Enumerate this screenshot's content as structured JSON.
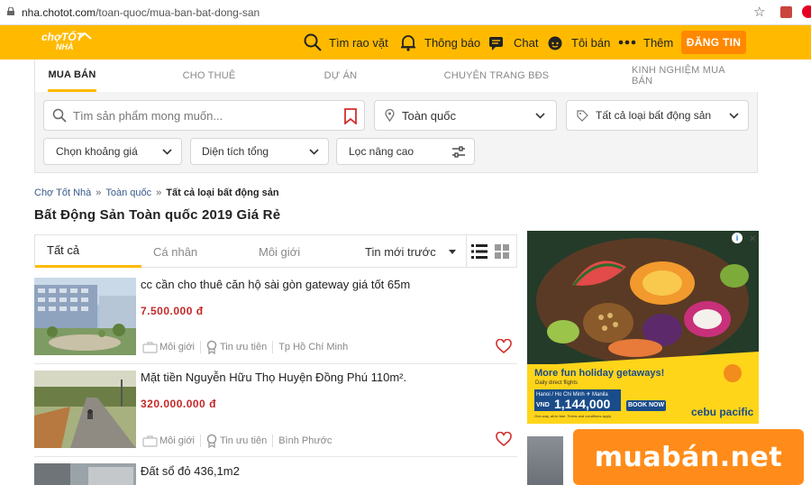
{
  "browser": {
    "url_host": "nha.chotot.com",
    "url_path": "/toan-quoc/mua-ban-bat-dong-san"
  },
  "header": {
    "logo_top": "chợTỐT",
    "logo_bottom": "NHÀ",
    "nav": [
      {
        "label": "Tìm rao vặt",
        "icon": "search-icon"
      },
      {
        "label": "Thông báo",
        "icon": "bell-icon"
      },
      {
        "label": "Chat",
        "icon": "chat-icon"
      },
      {
        "label": "Tôi bán",
        "icon": "user-face-icon"
      },
      {
        "label": "Thêm",
        "icon": "more-dots-icon"
      }
    ],
    "post_button": "ĐĂNG TIN",
    "brand_color": "#ffba00"
  },
  "search": {
    "tabs": [
      {
        "label": "MUA BÁN",
        "active": true
      },
      {
        "label": "CHO THUÊ",
        "active": false
      },
      {
        "label": "DỰ ÁN",
        "active": false
      },
      {
        "label": "CHUYÊN TRANG BĐS",
        "active": false
      },
      {
        "label": "KINH NGHIỆM MUA BÁN",
        "active": false
      }
    ],
    "keyword_placeholder": "Tìm sản phẩm mong muốn...",
    "location": "Toàn quốc",
    "category": "Tất cả loại bất động sản",
    "price_range": "Chọn khoảng giá",
    "area": "Diện tích tổng",
    "advanced_filter": "Lọc nâng cao"
  },
  "breadcrumb": {
    "items": [
      "Chợ Tốt Nhà",
      "Toàn quốc"
    ],
    "current": "Tất cả loại bất động sản",
    "separator": "»"
  },
  "page_title": "Bất Động Sản Toàn quốc 2019 Giá Rẻ",
  "list_filter": {
    "tabs": [
      "Tất cả",
      "Cá nhân",
      "Môi giới"
    ],
    "sort": "Tin mới trước"
  },
  "listings": [
    {
      "title": "cc cần cho thuê căn hộ sài gòn gateway giá tốt 65m",
      "price": "7.500.000 đ",
      "seller_type": "Môi giới",
      "badge": "Tin ưu tiên",
      "location": "Tp Hồ Chí Minh"
    },
    {
      "title": "Mặt tiền Nguyễn Hữu Thọ Huyện Đồng Phú 110m².",
      "price": "320.000.000 đ",
      "seller_type": "Môi giới",
      "badge": "Tin ưu tiên",
      "location": "Bình Phước"
    },
    {
      "title": "Đất sổ đỏ 436,1m2",
      "price": "",
      "seller_type": "",
      "badge": "",
      "location": ""
    }
  ],
  "ad": {
    "headline": "More fun holiday getaways!",
    "sub": "Daily direct flights",
    "route": "Hanoi / Ho Chi Minh ✈ Manila",
    "currency": "VND",
    "price": "1,144,000",
    "cta": "BOOK NOW",
    "terms": "One-way, all-in fare. Terms and conditions apply.",
    "brand": "cebu pacific"
  },
  "watermark": "muabán.net"
}
